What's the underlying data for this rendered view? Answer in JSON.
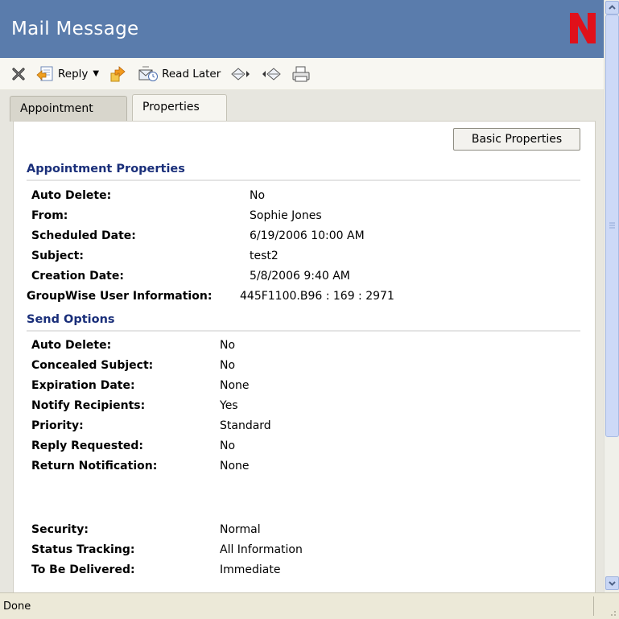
{
  "window": {
    "title": "Mail Message"
  },
  "toolbar": {
    "reply_label": "Reply",
    "read_later_label": "Read Later"
  },
  "tabs": [
    {
      "label": "Appointment",
      "active": false
    },
    {
      "label": "Properties",
      "active": true
    }
  ],
  "basic_properties_button": "Basic Properties",
  "appointment_properties": {
    "title": "Appointment  Properties",
    "rows": [
      {
        "label": "Auto Delete:",
        "value": "No"
      },
      {
        "label": "From:",
        "value": "Sophie Jones"
      },
      {
        "label": "Scheduled Date:",
        "value": "6/19/2006 10:00 AM"
      },
      {
        "label": "Subject:",
        "value": "test2"
      },
      {
        "label": "Creation Date:",
        "value": "5/8/2006 9:40 AM"
      },
      {
        "label": "GroupWise User Information:",
        "value": "445F1100.B96 : 169 : 2971"
      }
    ]
  },
  "send_options": {
    "title": "Send Options",
    "rows": [
      {
        "label": "Auto Delete:",
        "value": "No"
      },
      {
        "label": "Concealed Subject:",
        "value": "No"
      },
      {
        "label": "Expiration Date:",
        "value": "None"
      },
      {
        "label": "Notify Recipients:",
        "value": "Yes"
      },
      {
        "label": "Priority:",
        "value": "Standard"
      },
      {
        "label": "Reply Requested:",
        "value": "No"
      },
      {
        "label": "Return Notification:",
        "value": "None"
      },
      {
        "label": "Security:",
        "value": "Normal"
      },
      {
        "label": "Status Tracking:",
        "value": "All Information"
      },
      {
        "label": "To Be Delivered:",
        "value": "Immediate"
      }
    ]
  },
  "status": {
    "text": "Done"
  },
  "colors": {
    "title_bar": "#5a7cac",
    "logo_red": "#e0101a",
    "section_title": "#1a2f7a"
  },
  "icons": [
    "close-icon",
    "reply-icon",
    "forward-icon",
    "read-later-icon",
    "next-item-icon",
    "previous-item-icon",
    "print-icon",
    "novell-logo-icon"
  ]
}
